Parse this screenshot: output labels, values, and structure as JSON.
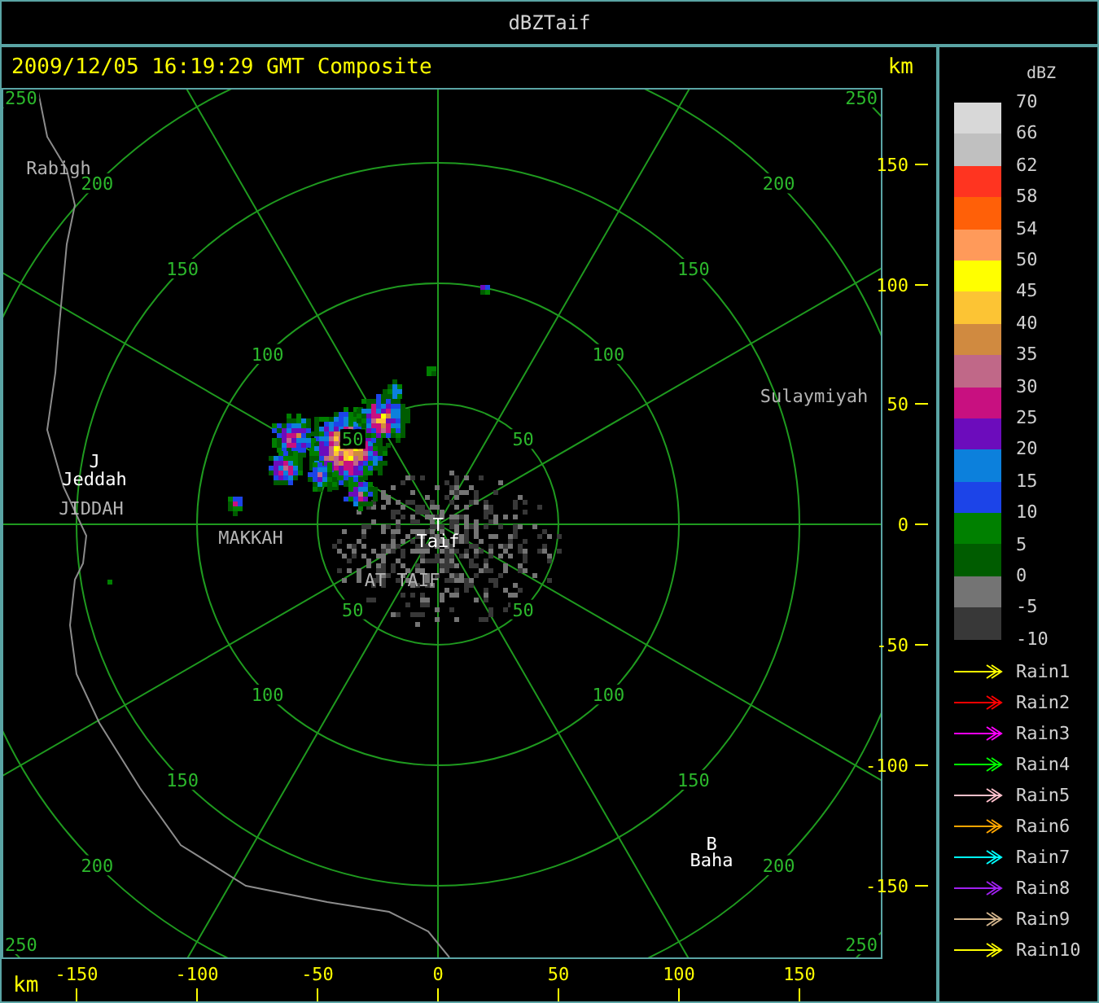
{
  "window": {
    "title": "dBZTaif"
  },
  "header": {
    "timestamp": "2009/12/05 16:19:29 GMT Composite",
    "unit": "km"
  },
  "map": {
    "range_ring_labels": [
      "250",
      "250",
      "200",
      "200",
      "150",
      "150",
      "100",
      "100",
      "50",
      "50",
      "50",
      "50",
      "100",
      "100",
      "150",
      "150",
      "200",
      "200",
      "250",
      "250"
    ],
    "places": [
      {
        "text": "Rabigh",
        "kind": "region"
      },
      {
        "text": "J",
        "kind": "marker"
      },
      {
        "text": "Jeddah",
        "kind": "city"
      },
      {
        "text": "JIDDAH",
        "kind": "region"
      },
      {
        "text": "MAKKAH",
        "kind": "region"
      },
      {
        "text": "T",
        "kind": "marker"
      },
      {
        "text": "Taif",
        "kind": "city"
      },
      {
        "text": "AT TAIF",
        "kind": "region"
      },
      {
        "text": "Sulaymiyah",
        "kind": "region"
      },
      {
        "text": "B",
        "kind": "marker"
      },
      {
        "text": "Baha",
        "kind": "city"
      }
    ]
  },
  "y_axis": {
    "ticks": [
      "150",
      "100",
      "50",
      "0",
      "-50",
      "-100",
      "-150"
    ]
  },
  "x_axis": {
    "unit": "km",
    "ticks": [
      "-150",
      "-100",
      "-50",
      "0",
      "50",
      "100",
      "150"
    ]
  },
  "legend": {
    "title": "dBZ",
    "bands": [
      {
        "color": "#d8d8d8"
      },
      {
        "color": "#c0c0c0"
      },
      {
        "color": "#ff3420"
      },
      {
        "color": "#ff6008"
      },
      {
        "color": "#ff9a5a"
      },
      {
        "color": "#ffff00"
      },
      {
        "color": "#fcc434"
      },
      {
        "color": "#d08a40"
      },
      {
        "color": "#c06888"
      },
      {
        "color": "#c81080"
      },
      {
        "color": "#6c0cbc"
      },
      {
        "color": "#0c80dc"
      },
      {
        "color": "#1c44e8"
      },
      {
        "color": "#008000"
      },
      {
        "color": "#005c00"
      },
      {
        "color": "#747474"
      },
      {
        "color": "#383838"
      }
    ],
    "labels": [
      "70",
      "66",
      "62",
      "58",
      "54",
      "50",
      "45",
      "40",
      "35",
      "30",
      "25",
      "20",
      "15",
      "10",
      "5",
      "0",
      "-5",
      "-10"
    ],
    "tracks": [
      {
        "label": "Rain1",
        "color": "#ffff00"
      },
      {
        "label": "Rain2",
        "color": "#ff0000"
      },
      {
        "label": "Rain3",
        "color": "#ff00ff"
      },
      {
        "label": "Rain4",
        "color": "#00ff00"
      },
      {
        "label": "Rain5",
        "color": "#ffc0cb"
      },
      {
        "label": "Rain6",
        "color": "#ffa500"
      },
      {
        "label": "Rain7",
        "color": "#00ffff"
      },
      {
        "label": "Rain8",
        "color": "#a020f0"
      },
      {
        "label": "Rain9",
        "color": "#d2b48c"
      },
      {
        "label": "Rain10",
        "color": "#ffff00"
      }
    ]
  }
}
